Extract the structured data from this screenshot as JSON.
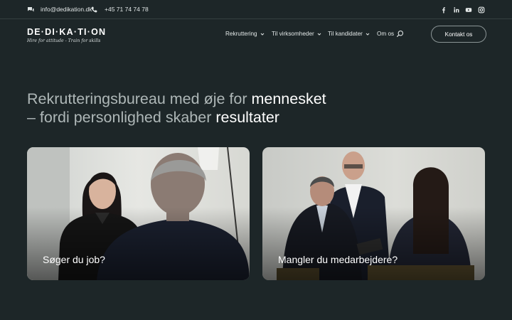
{
  "topbar": {
    "email": "info@dedikation.dk",
    "phone": "+45 71 74 74 78",
    "social_icons": [
      "facebook-icon",
      "linkedin-icon",
      "youtube-icon",
      "instagram-icon"
    ]
  },
  "logo": {
    "main": "DE·DI·KA·TI·ON",
    "tagline": "Hire for attitude - Train for skills"
  },
  "nav": {
    "items": [
      {
        "label": "Rekruttering",
        "dropdown": true
      },
      {
        "label": "Til virksomheder",
        "dropdown": true
      },
      {
        "label": "Til kandidater",
        "dropdown": true
      },
      {
        "label": "Om os",
        "dropdown": false
      }
    ],
    "contact_label": "Kontakt os"
  },
  "hero": {
    "line1_a": "Rekrutteringsbureau med øje for ",
    "line1_b": "mennesket",
    "line2_a": "– fordi personlighed skaber ",
    "line2_b": "resultater"
  },
  "cards": [
    {
      "label": "Søger du job?"
    },
    {
      "label": "Mangler du medarbejdere?"
    }
  ],
  "colors": {
    "background": "#1d2628",
    "text": "#ffffff",
    "muted_text": "#aeb7b7",
    "button_border": "#8b9596"
  }
}
